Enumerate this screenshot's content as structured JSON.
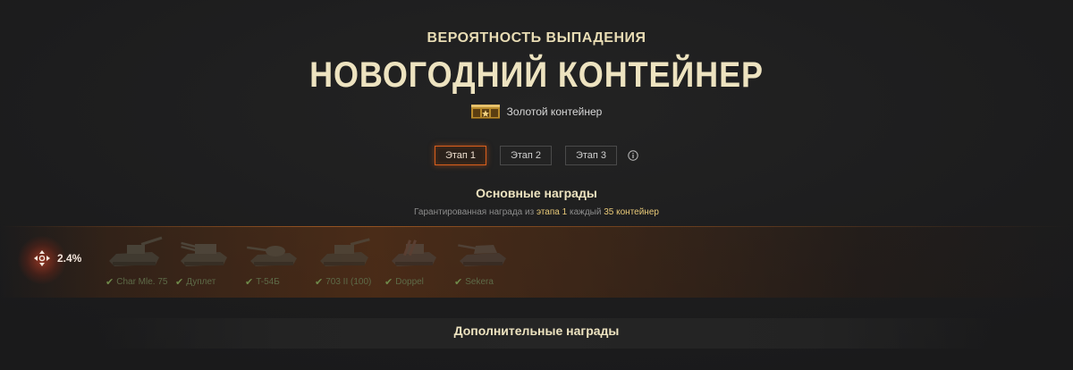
{
  "header": {
    "subtitle": "ВЕРОЯТНОСТЬ ВЫПАДЕНИЯ",
    "title": "НОВОГОДНИЙ КОНТЕЙНЕР",
    "container_type": "Золотой контейнер",
    "container_icon": "gold-chest-icon"
  },
  "stages": [
    {
      "label": "Этап 1",
      "active": true
    },
    {
      "label": "Этап 2",
      "active": false
    },
    {
      "label": "Этап 3",
      "active": false
    }
  ],
  "main_rewards": {
    "title": "Основные награды",
    "guarantee_prefix": "Гарантированная награда из",
    "guarantee_stage": "этапа 1",
    "guarantee_middle": "каждый",
    "guarantee_count": "35 контейнер",
    "chance": "2.4%",
    "tanks": [
      {
        "name": "Char Mle. 75",
        "owned": true
      },
      {
        "name": "Дуплет",
        "owned": true
      },
      {
        "name": "T-54Б",
        "owned": true
      },
      {
        "name": "703 II (100)",
        "owned": true
      },
      {
        "name": "Doppel",
        "owned": true
      },
      {
        "name": "Sekera",
        "owned": true
      }
    ]
  },
  "extra_rewards": {
    "title": "Дополнительные награды"
  },
  "colors": {
    "accent": "#d85e1c",
    "gold_text": "#e8c978",
    "title_text": "#ede3c0",
    "owned_check": "#6f8a4a"
  }
}
